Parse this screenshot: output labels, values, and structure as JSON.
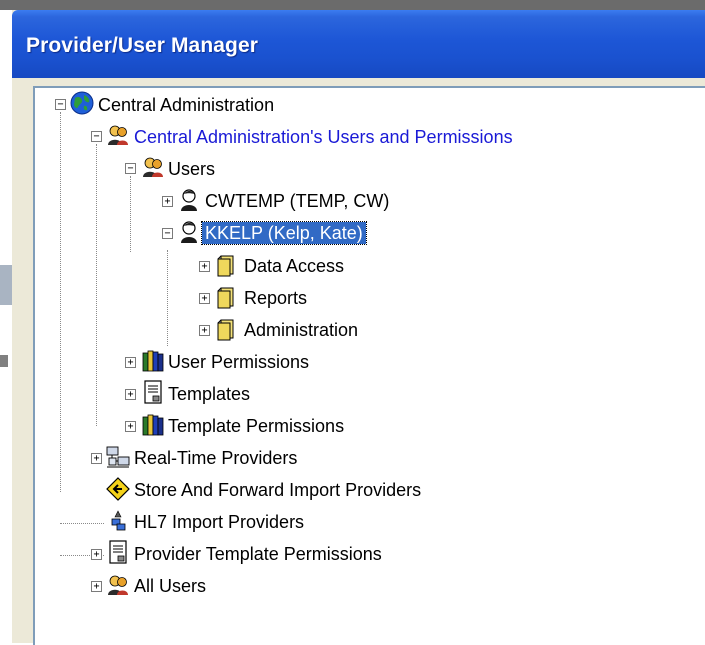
{
  "window": {
    "title": "Provider/User Manager"
  },
  "tree": {
    "root": {
      "label": "Central Administration",
      "icon": "globe-icon",
      "expander": "−"
    },
    "admin_users": {
      "label": "Central Administration's Users and Permissions",
      "icon": "users-icon",
      "expander": "−"
    },
    "users": {
      "label": "Users",
      "icon": "users-icon",
      "expander": "−"
    },
    "cwtemp": {
      "label": "CWTEMP (TEMP, CW)",
      "icon": "user-icon",
      "expander": "+"
    },
    "kkelp": {
      "label": "KKELP (Kelp, Kate)",
      "icon": "user-icon",
      "expander": "−",
      "selected": true
    },
    "data_access": {
      "label": "Data Access",
      "icon": "folder-icon",
      "expander": "+"
    },
    "reports": {
      "label": "Reports",
      "icon": "folder-icon",
      "expander": "+"
    },
    "administration": {
      "label": "Administration",
      "icon": "folder-icon",
      "expander": "+"
    },
    "user_permissions": {
      "label": "User Permissions",
      "icon": "books-icon",
      "expander": "+"
    },
    "templates": {
      "label": "Templates",
      "icon": "document-icon",
      "expander": "+"
    },
    "template_permissions": {
      "label": "Template Permissions",
      "icon": "books-icon",
      "expander": "+"
    },
    "realtime_providers": {
      "label": "Real-Time Providers",
      "icon": "network-icon",
      "expander": "+"
    },
    "store_forward": {
      "label": "Store And Forward Import Providers",
      "icon": "diamond-arrow-icon"
    },
    "hl7_import": {
      "label": "HL7 Import Providers",
      "icon": "hl7-icon"
    },
    "provider_template_permissions": {
      "label": "Provider Template Permissions",
      "icon": "document-icon",
      "expander": "+"
    },
    "all_users": {
      "label": "All Users",
      "icon": "users-icon",
      "expander": "+"
    }
  },
  "colors": {
    "title_bar": "#1d56d6",
    "link_text": "#1a1ad6",
    "selection": "#316ac5"
  }
}
